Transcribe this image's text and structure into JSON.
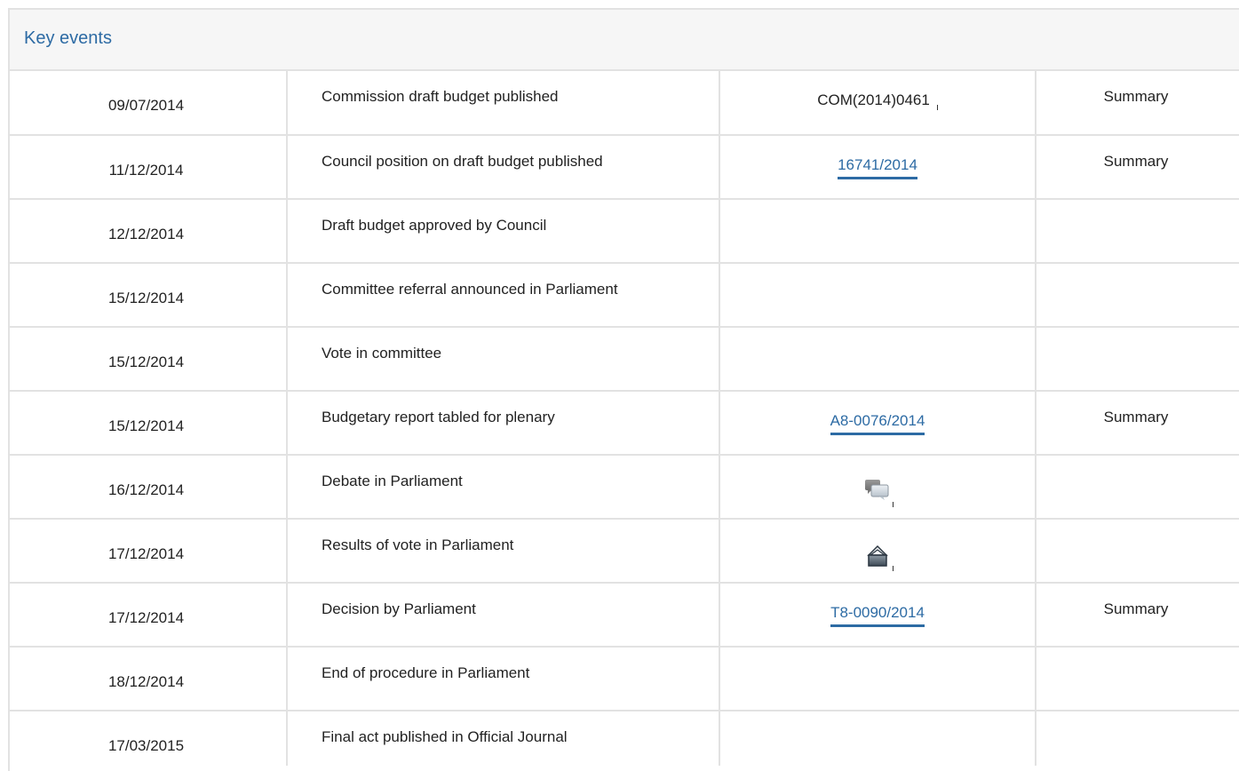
{
  "panel": {
    "title": "Key events"
  },
  "rows": [
    {
      "date": "09/07/2014",
      "event": "Commission draft budget published",
      "doc": "COM(2014)0461",
      "doc_type": "text",
      "summary": "Summary"
    },
    {
      "date": "11/12/2014",
      "event": "Council position on draft budget published",
      "doc": "16741/2014",
      "doc_type": "link",
      "summary": "Summary"
    },
    {
      "date": "12/12/2014",
      "event": "Draft budget approved by Council",
      "doc": "",
      "doc_type": "none",
      "summary": ""
    },
    {
      "date": "15/12/2014",
      "event": "Committee referral announced in Parliament",
      "doc": "",
      "doc_type": "none",
      "summary": ""
    },
    {
      "date": "15/12/2014",
      "event": "Vote in committee",
      "doc": "",
      "doc_type": "none",
      "summary": ""
    },
    {
      "date": "15/12/2014",
      "event": "Budgetary report tabled for plenary",
      "doc": "A8-0076/2014",
      "doc_type": "link",
      "summary": "Summary"
    },
    {
      "date": "16/12/2014",
      "event": "Debate in Parliament",
      "doc": "",
      "doc_type": "icon",
      "icon": "debate-icon",
      "summary": ""
    },
    {
      "date": "17/12/2014",
      "event": "Results of vote in Parliament",
      "doc": "",
      "doc_type": "icon",
      "icon": "ballot-box-icon",
      "summary": ""
    },
    {
      "date": "17/12/2014",
      "event": "Decision by Parliament",
      "doc": "T8-0090/2014",
      "doc_type": "link",
      "summary": "Summary"
    },
    {
      "date": "18/12/2014",
      "event": "End of procedure in Parliament",
      "doc": "",
      "doc_type": "none",
      "summary": ""
    },
    {
      "date": "17/03/2015",
      "event": "Final act published in Official Journal",
      "doc": "",
      "doc_type": "none",
      "summary": ""
    }
  ],
  "colors": {
    "link": "#2d6ba4",
    "border": "#e2e2e2",
    "header_bg": "#f6f6f6"
  }
}
